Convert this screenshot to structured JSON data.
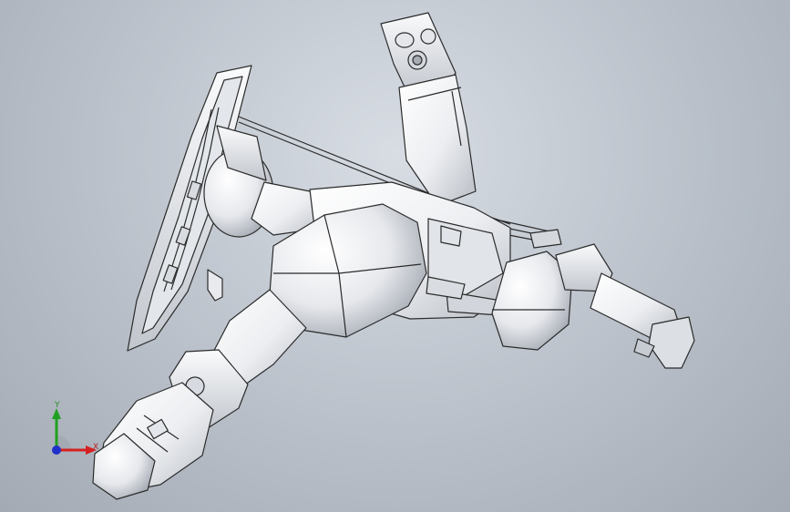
{
  "viewport": {
    "background_top": "#d8dde4",
    "background_bottom": "#a3aab4",
    "model_fill": "#f2f3f5",
    "model_shade": "#c9ccd2",
    "edge_color": "#2b2b2b"
  },
  "triad": {
    "x_label": "X",
    "y_label": "Y",
    "x_color": "#d42020",
    "y_color": "#20a020",
    "z_color": "#2030c8"
  }
}
